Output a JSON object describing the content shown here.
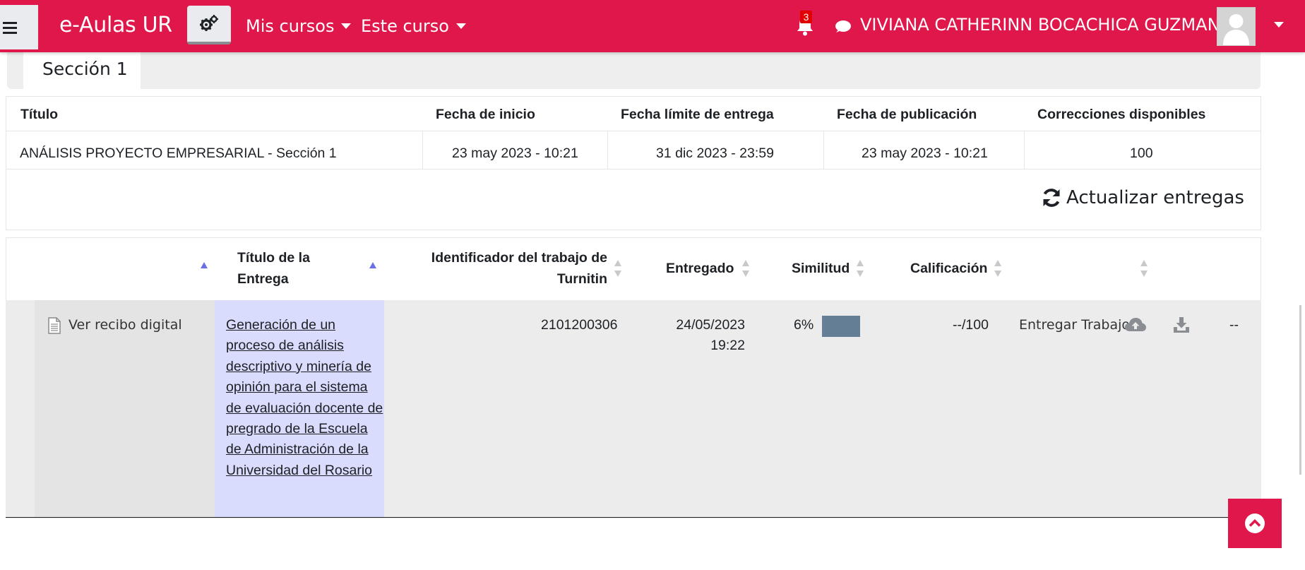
{
  "navbar": {
    "brand": "e-Aulas UR",
    "menus": [
      "Mis cursos",
      "Este curso"
    ],
    "notification_count": "3",
    "user_name": "VIVIANA CATHERINN BOCACHICA GUZMAN",
    "accent_color": "#e0174a"
  },
  "section_tab": "Sección 1",
  "assignment_info": {
    "headers": [
      "Título",
      "Fecha de inicio",
      "Fecha límite de entrega",
      "Fecha de publicación",
      "Correcciones disponibles"
    ],
    "row": [
      "ANÁLISIS PROYECTO EMPRESARIAL - Sección 1",
      "23 may 2023 - 10:21",
      "31 dic 2023 - 23:59",
      "23 may 2023 - 10:21",
      "100"
    ]
  },
  "refresh_label": "Actualizar entregas",
  "submissions": {
    "headers": {
      "title_line1": "Título de la",
      "title_line2": "Entrega",
      "turnitin_line1": "Identificador del trabajo de",
      "turnitin_line2": "Turnitin",
      "submitted": "Entregado",
      "similarity": "Similitud",
      "grade": "Calificación"
    },
    "row": {
      "receipt_label": "Ver recibo digital",
      "title": "Generación de un proceso de análisis descriptivo y minería de opinión para el sistema de evaluación docente de pregrado de la Escuela de Administración de la Universidad del Rosario",
      "paper_id": "2101200306",
      "submitted_date": "24/05/2023",
      "submitted_time": "19:22",
      "similarity": "6%",
      "similarity_color": "#647e95",
      "grade": "--/100",
      "submit_label": "Entregar Trabajo",
      "last_col": "--"
    }
  }
}
